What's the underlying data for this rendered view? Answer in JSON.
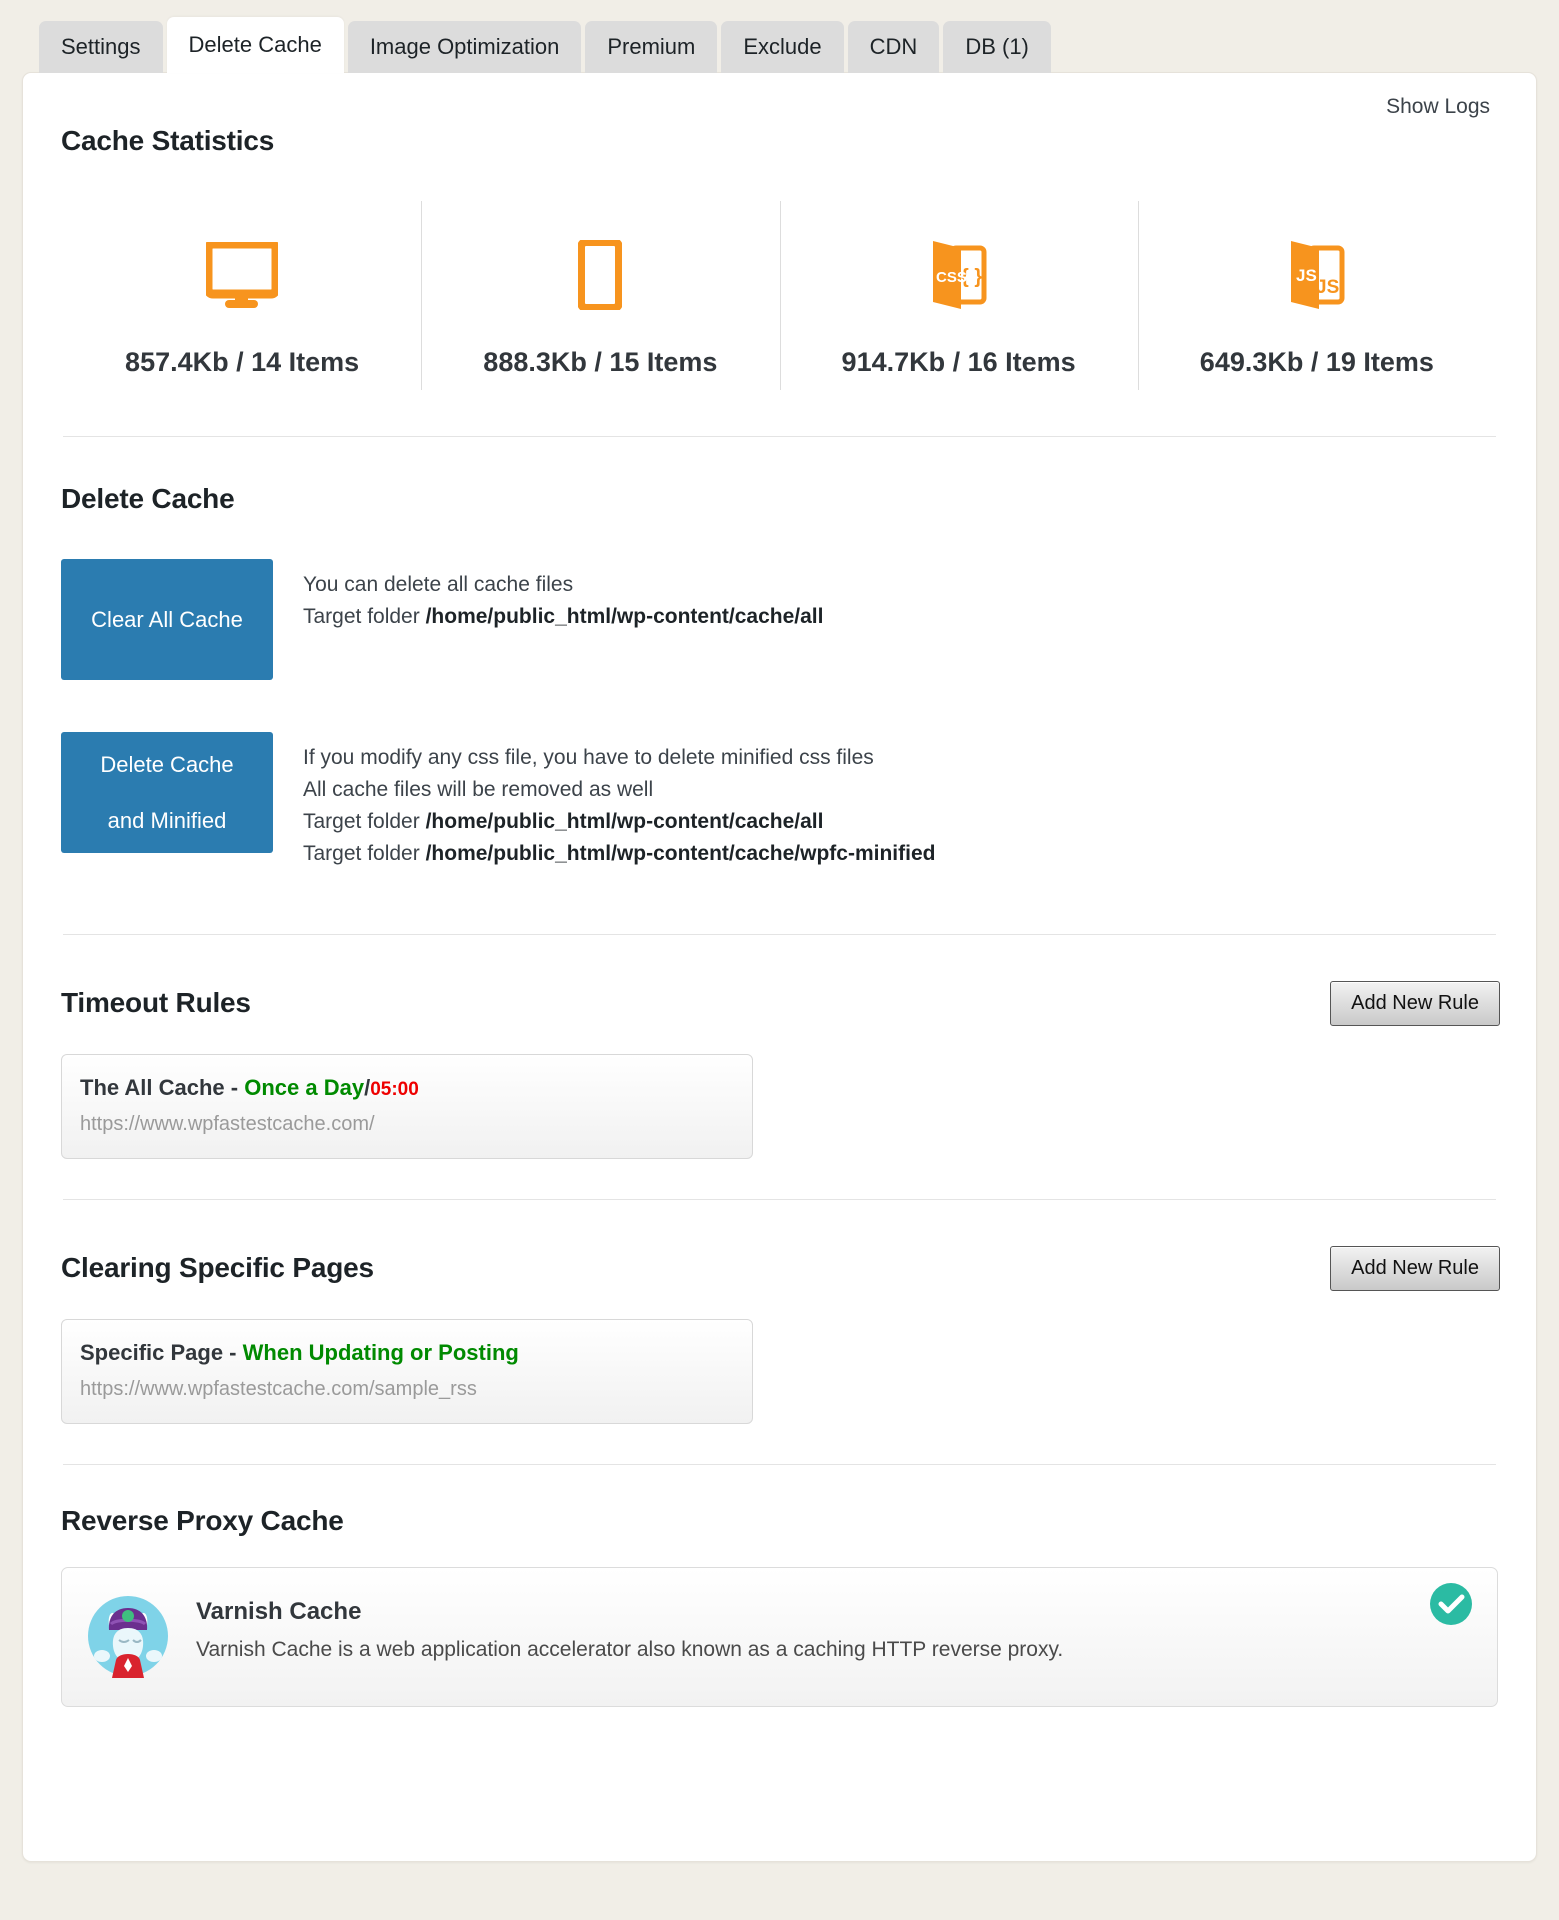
{
  "tabs": [
    {
      "label": "Settings",
      "active": false
    },
    {
      "label": "Delete Cache",
      "active": true
    },
    {
      "label": "Image Optimization",
      "active": false
    },
    {
      "label": "Premium",
      "active": false
    },
    {
      "label": "Exclude",
      "active": false
    },
    {
      "label": "CDN",
      "active": false
    },
    {
      "label": "DB (1)",
      "active": false
    }
  ],
  "colors": {
    "accent_blue": "#2b7cb0",
    "orange": "#f7941e",
    "green": "#008a00",
    "red": "#ee0000",
    "teal_check": "#2bbba3",
    "page_bg": "#f1eee7"
  },
  "header": {
    "show_logs_label": "Show Logs"
  },
  "cache_statistics": {
    "title": "Cache Statistics",
    "items": [
      {
        "icon": "desktop-icon",
        "value": "857.4Kb / 14 Items"
      },
      {
        "icon": "mobile-icon",
        "value": "888.3Kb / 15 Items"
      },
      {
        "icon": "css-file-icon",
        "value": "914.7Kb / 16 Items"
      },
      {
        "icon": "js-file-icon",
        "value": "649.3Kb / 19 Items"
      }
    ]
  },
  "delete_cache": {
    "title": "Delete Cache",
    "actions": [
      {
        "button_line1": "Clear All Cache",
        "button_line2": "",
        "lines": [
          {
            "text": "You can delete all cache files",
            "path": ""
          },
          {
            "text": "Target folder ",
            "path": "/home/public_html/wp-content/cache/all"
          }
        ]
      },
      {
        "button_line1": "Delete Cache",
        "button_line2": "and Minified",
        "lines": [
          {
            "text": "If you modify any css file, you have to delete minified css files",
            "path": ""
          },
          {
            "text": "All cache files will be removed as well",
            "path": ""
          },
          {
            "text": "Target folder ",
            "path": "/home/public_html/wp-content/cache/all"
          },
          {
            "text": "Target folder ",
            "path": "/home/public_html/wp-content/cache/wpfc-minified"
          }
        ]
      }
    ]
  },
  "timeout_rules": {
    "title": "Timeout Rules",
    "add_button_label": "Add New Rule",
    "rules": [
      {
        "prefix": "The All Cache - ",
        "highlight": "Once a Day",
        "separator": "/",
        "time": "05:00",
        "url": "https://www.wpfastestcache.com/"
      }
    ]
  },
  "clearing_specific_pages": {
    "title": "Clearing Specific Pages",
    "add_button_label": "Add New Rule",
    "rules": [
      {
        "prefix": "Specific Page - ",
        "highlight": "When Updating or Posting",
        "separator": "",
        "time": "",
        "url": "https://www.wpfastestcache.com/sample_rss"
      }
    ]
  },
  "reverse_proxy_cache": {
    "title": "Reverse Proxy Cache",
    "entries": [
      {
        "name": "Varnish Cache",
        "description": "Varnish Cache is a web application accelerator also known as a caching HTTP reverse proxy.",
        "avatar": "varnish-logo-icon",
        "status_icon": "check-circle-icon",
        "enabled": true
      }
    ]
  }
}
